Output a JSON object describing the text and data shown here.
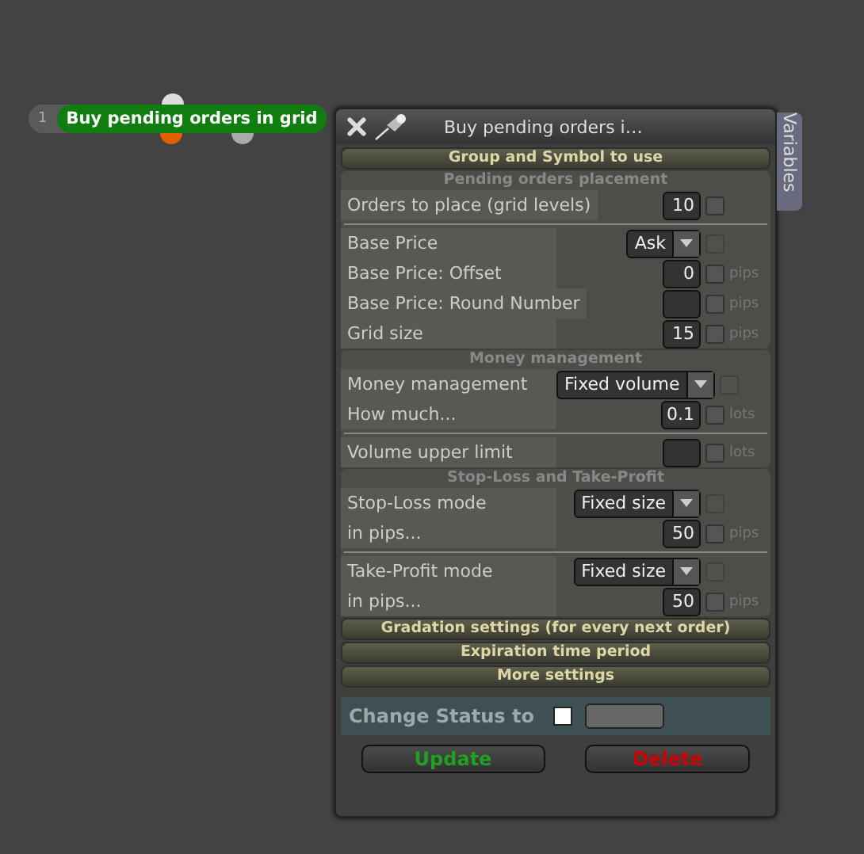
{
  "node": {
    "index": "1",
    "title": "Buy pending orders in grid"
  },
  "panel": {
    "title": "Buy pending orders i…",
    "side_tab": "Variables"
  },
  "sections": [
    {
      "title": "Group and Symbol to use",
      "expanded": false
    },
    {
      "title": "Pending orders placement",
      "expanded": true,
      "groups": [
        [
          {
            "label": "Orders to place (grid levels)",
            "kind": "number",
            "value": "10",
            "checked": false
          }
        ],
        [
          {
            "label": "Base Price",
            "kind": "select",
            "value": "Ask",
            "checked": false
          },
          {
            "label": "Base Price: Offset",
            "kind": "number",
            "value": "0",
            "unit": "pips",
            "checked": false
          },
          {
            "label": "Base Price: Round Number",
            "kind": "number",
            "unit": "pips",
            "checked": false
          },
          {
            "label": "Grid size",
            "kind": "number",
            "value": "15",
            "unit": "pips",
            "checked": false
          }
        ]
      ]
    },
    {
      "title": "Money management",
      "expanded": true,
      "groups": [
        [
          {
            "label": "Money management",
            "kind": "select",
            "value": "Fixed volume",
            "checked": false
          },
          {
            "label": "How much...",
            "kind": "number",
            "value": "0.1",
            "unit": "lots",
            "checked": false
          }
        ],
        [
          {
            "label": "Volume upper limit",
            "kind": "number",
            "unit": "lots",
            "checked": false
          }
        ]
      ]
    },
    {
      "title": "Stop-Loss and Take-Profit",
      "expanded": true,
      "groups": [
        [
          {
            "label": "Stop-Loss mode",
            "kind": "select",
            "value": "Fixed size",
            "checked": false
          },
          {
            "label": "in pips...",
            "kind": "number",
            "value": "50",
            "unit": "pips",
            "checked": false
          }
        ],
        [
          {
            "label": "Take-Profit mode",
            "kind": "select",
            "value": "Fixed size",
            "checked": false
          },
          {
            "label": "in pips...",
            "kind": "number",
            "value": "50",
            "unit": "pips",
            "checked": false
          }
        ]
      ]
    },
    {
      "title": "Gradation settings (for every next order)",
      "expanded": false
    },
    {
      "title": "Expiration time period",
      "expanded": false
    },
    {
      "title": "More settings",
      "expanded": false
    }
  ],
  "status": {
    "label": "Change Status to",
    "checked": false
  },
  "buttons": [
    {
      "label": "Update",
      "kind": "update"
    },
    {
      "label": "Delete",
      "kind": "delete"
    }
  ]
}
